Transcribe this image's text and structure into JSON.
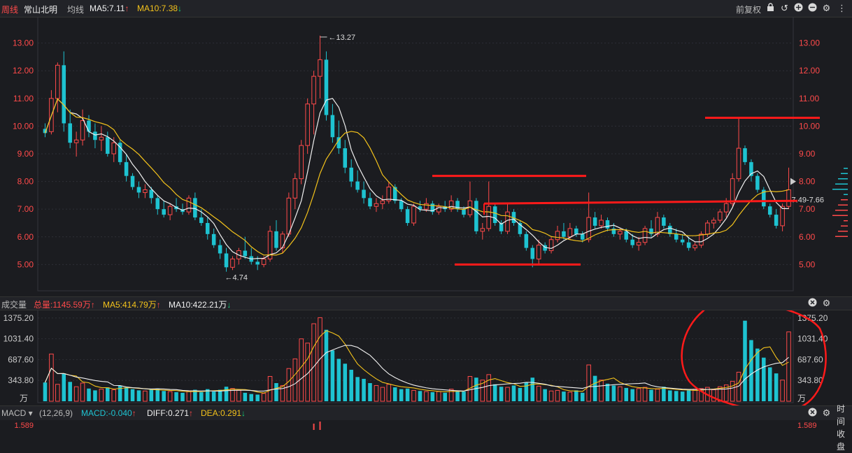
{
  "header": {
    "period": "周线",
    "stock_name": "常山北明",
    "ma_label": "均线",
    "ma5": "MA5:7.11",
    "ma10": "MA10:7.38",
    "adjust": "前复权"
  },
  "volume_header": {
    "title": "成交量",
    "total": "总量:1145.59万",
    "ma5": "MA5:414.79万",
    "ma10": "MA10:422.21万"
  },
  "macd_header": {
    "indicator": "MACD",
    "params": "(12,26,9)",
    "macd": "MACD:-0.040",
    "diff": "DIFF:0.271",
    "dea": "DEA:0.291"
  },
  "right_panel": {
    "time_label": "时间",
    "close_label": "收盘"
  },
  "colors": {
    "up": "#ff4a4a",
    "down": "#1ec3d1",
    "ma5": "#f0f0f0",
    "ma10": "#f3c21b",
    "annotation": "#ff1a1a",
    "grid": "#2e2f36",
    "axis_text": "#ff4a4a"
  },
  "chart_data": {
    "type": "candlestick",
    "price_axis": {
      "ticks": [
        "13.00",
        "12.00",
        "11.00",
        "10.00",
        "9.00",
        "8.00",
        "7.00",
        "6.00",
        "5.00"
      ],
      "ylim": [
        4.1,
        13.9
      ]
    },
    "price_annotations": {
      "high": "13.27",
      "low": "4.74",
      "current_range": "7.49-7.66"
    },
    "volume_axis": {
      "ticks": [
        "1375.20",
        "1031.40",
        "687.60",
        "343.80"
      ],
      "unit": "万",
      "ylim": [
        0,
        1500
      ]
    },
    "macd_axis": {
      "top_value": "1.589"
    },
    "candles": [
      [
        9.9,
        10.1,
        9.6,
        9.75
      ],
      [
        9.8,
        11.3,
        9.7,
        11.0
      ],
      [
        11.0,
        12.3,
        10.5,
        12.2
      ],
      [
        12.2,
        12.7,
        9.8,
        10.1
      ],
      [
        10.1,
        10.6,
        9.2,
        9.4
      ],
      [
        9.4,
        9.8,
        8.9,
        9.5
      ],
      [
        9.5,
        10.6,
        9.3,
        10.2
      ],
      [
        10.2,
        10.4,
        9.6,
        9.8
      ],
      [
        9.8,
        10.1,
        9.2,
        9.5
      ],
      [
        9.5,
        10.0,
        9.1,
        9.6
      ],
      [
        9.6,
        9.8,
        8.9,
        9.0
      ],
      [
        9.0,
        9.6,
        8.7,
        9.4
      ],
      [
        9.4,
        9.5,
        8.6,
        8.7
      ],
      [
        8.7,
        9.0,
        8.0,
        8.2
      ],
      [
        8.2,
        8.3,
        7.7,
        7.8
      ],
      [
        7.8,
        8.0,
        7.4,
        7.6
      ],
      [
        7.6,
        7.9,
        7.4,
        7.7
      ],
      [
        7.7,
        7.8,
        7.2,
        7.4
      ],
      [
        7.4,
        7.5,
        6.8,
        7.0
      ],
      [
        7.0,
        7.3,
        6.7,
        6.8
      ],
      [
        6.8,
        7.2,
        6.6,
        7.1
      ],
      [
        7.1,
        7.4,
        6.9,
        7.0
      ],
      [
        7.0,
        7.2,
        6.8,
        6.9
      ],
      [
        6.9,
        7.5,
        6.8,
        7.4
      ],
      [
        7.4,
        7.6,
        6.6,
        6.7
      ],
      [
        6.7,
        7.0,
        6.4,
        6.5
      ],
      [
        6.5,
        6.7,
        5.9,
        6.1
      ],
      [
        6.1,
        6.3,
        5.6,
        5.7
      ],
      [
        5.7,
        5.9,
        5.2,
        5.4
      ],
      [
        5.4,
        5.6,
        4.74,
        4.9
      ],
      [
        4.9,
        5.3,
        4.8,
        5.2
      ],
      [
        5.2,
        5.6,
        5.0,
        5.5
      ],
      [
        5.5,
        6.0,
        5.2,
        5.3
      ],
      [
        5.3,
        5.6,
        5.0,
        5.1
      ],
      [
        5.1,
        5.3,
        4.8,
        5.0
      ],
      [
        5.0,
        5.3,
        4.9,
        5.2
      ],
      [
        5.2,
        6.4,
        5.1,
        6.2
      ],
      [
        6.2,
        6.6,
        5.5,
        5.6
      ],
      [
        5.6,
        6.2,
        5.4,
        6.1
      ],
      [
        6.1,
        7.6,
        6.0,
        7.4
      ],
      [
        7.4,
        8.3,
        7.0,
        8.1
      ],
      [
        8.1,
        9.5,
        7.9,
        9.3
      ],
      [
        9.3,
        11.0,
        9.0,
        10.8
      ],
      [
        10.8,
        12.0,
        9.7,
        11.8
      ],
      [
        11.8,
        13.27,
        11.0,
        12.4
      ],
      [
        12.4,
        12.7,
        10.2,
        10.4
      ],
      [
        10.4,
        10.8,
        9.4,
        9.6
      ],
      [
        9.6,
        10.2,
        9.0,
        9.2
      ],
      [
        9.2,
        9.5,
        8.3,
        8.5
      ],
      [
        8.5,
        8.8,
        7.8,
        8.0
      ],
      [
        8.0,
        8.4,
        7.6,
        7.7
      ],
      [
        7.7,
        8.0,
        7.2,
        7.4
      ],
      [
        7.4,
        7.6,
        7.0,
        7.1
      ],
      [
        7.1,
        7.4,
        6.9,
        7.2
      ],
      [
        7.2,
        7.5,
        7.0,
        7.3
      ],
      [
        7.3,
        8.0,
        7.2,
        7.8
      ],
      [
        7.8,
        7.9,
        7.2,
        7.3
      ],
      [
        7.3,
        7.4,
        6.9,
        7.0
      ],
      [
        7.0,
        7.1,
        6.4,
        6.5
      ],
      [
        6.5,
        7.2,
        6.4,
        7.1
      ],
      [
        7.1,
        7.3,
        6.9,
        7.0
      ],
      [
        7.0,
        7.4,
        6.9,
        7.2
      ],
      [
        7.2,
        7.3,
        6.8,
        6.9
      ],
      [
        6.9,
        7.2,
        6.8,
        7.1
      ],
      [
        7.1,
        7.3,
        6.9,
        7.0
      ],
      [
        7.0,
        7.5,
        6.9,
        7.3
      ],
      [
        7.3,
        7.4,
        6.9,
        7.0
      ],
      [
        7.0,
        7.1,
        6.7,
        6.8
      ],
      [
        6.8,
        8.0,
        6.7,
        7.3
      ],
      [
        7.3,
        7.4,
        6.1,
        6.2
      ],
      [
        6.2,
        6.5,
        5.9,
        6.3
      ],
      [
        6.3,
        8.0,
        6.2,
        7.1
      ],
      [
        7.1,
        7.2,
        6.4,
        6.5
      ],
      [
        6.5,
        6.6,
        6.1,
        6.2
      ],
      [
        6.2,
        7.2,
        6.1,
        6.9
      ],
      [
        6.9,
        7.0,
        6.4,
        6.5
      ],
      [
        6.5,
        6.6,
        6.0,
        6.1
      ],
      [
        6.1,
        6.2,
        5.5,
        5.6
      ],
      [
        5.6,
        5.7,
        4.9,
        5.2
      ],
      [
        5.2,
        5.9,
        5.0,
        5.7
      ],
      [
        5.7,
        5.8,
        5.4,
        5.5
      ],
      [
        5.5,
        6.0,
        5.4,
        5.9
      ],
      [
        5.9,
        6.4,
        5.8,
        6.2
      ],
      [
        6.2,
        6.5,
        5.9,
        6.0
      ],
      [
        6.0,
        6.5,
        5.9,
        6.3
      ],
      [
        6.3,
        6.4,
        6.0,
        6.1
      ],
      [
        6.1,
        6.2,
        5.8,
        5.9
      ],
      [
        5.9,
        7.6,
        5.8,
        6.7
      ],
      [
        6.7,
        6.9,
        6.3,
        6.4
      ],
      [
        6.4,
        6.8,
        6.3,
        6.6
      ],
      [
        6.6,
        6.7,
        6.2,
        6.3
      ],
      [
        6.3,
        6.5,
        6.0,
        6.1
      ],
      [
        6.1,
        6.3,
        5.9,
        6.2
      ],
      [
        6.2,
        6.3,
        5.8,
        5.9
      ],
      [
        5.9,
        6.1,
        5.6,
        5.7
      ],
      [
        5.7,
        6.0,
        5.5,
        5.8
      ],
      [
        5.8,
        6.4,
        5.7,
        6.3
      ],
      [
        6.3,
        6.6,
        6.0,
        6.1
      ],
      [
        6.1,
        6.9,
        6.0,
        6.7
      ],
      [
        6.7,
        6.8,
        6.3,
        6.4
      ],
      [
        6.4,
        6.5,
        6.0,
        6.1
      ],
      [
        6.1,
        6.3,
        5.8,
        5.9
      ],
      [
        5.9,
        6.1,
        5.7,
        5.8
      ],
      [
        5.8,
        6.0,
        5.5,
        5.6
      ],
      [
        5.6,
        5.8,
        5.5,
        5.7
      ],
      [
        5.7,
        6.2,
        5.6,
        6.1
      ],
      [
        6.1,
        6.6,
        6.0,
        6.5
      ],
      [
        6.5,
        6.7,
        6.3,
        6.6
      ],
      [
        6.6,
        7.0,
        6.5,
        6.9
      ],
      [
        6.9,
        7.4,
        6.7,
        7.2
      ],
      [
        7.2,
        8.3,
        7.1,
        8.1
      ],
      [
        8.1,
        10.3,
        8.0,
        9.2
      ],
      [
        9.2,
        9.3,
        8.6,
        8.7
      ],
      [
        8.7,
        8.8,
        8.0,
        8.2
      ],
      [
        8.2,
        8.3,
        7.6,
        7.7
      ],
      [
        7.7,
        7.8,
        7.0,
        7.1
      ],
      [
        7.1,
        7.2,
        6.7,
        6.8
      ],
      [
        6.8,
        7.0,
        6.3,
        6.4
      ],
      [
        6.4,
        7.2,
        6.2,
        7.1
      ],
      [
        7.1,
        8.5,
        7.0,
        7.7
      ]
    ],
    "volumes": [
      310,
      780,
      280,
      460,
      320,
      240,
      300,
      210,
      180,
      200,
      230,
      190,
      260,
      230,
      200,
      180,
      170,
      190,
      210,
      170,
      160,
      150,
      140,
      170,
      190,
      150,
      200,
      160,
      190,
      240,
      210,
      180,
      140,
      120,
      110,
      130,
      410,
      300,
      260,
      540,
      700,
      1030,
      960,
      1280,
      1380,
      1180,
      840,
      700,
      620,
      520,
      400,
      370,
      300,
      260,
      230,
      280,
      230,
      200,
      210,
      180,
      170,
      160,
      150,
      160,
      140,
      200,
      170,
      160,
      410,
      390,
      350,
      440,
      280,
      240,
      230,
      260,
      220,
      310,
      390,
      250,
      200,
      170,
      180,
      160,
      150,
      180,
      140,
      600,
      420,
      350,
      290,
      260,
      240,
      220,
      200,
      210,
      230,
      190,
      200,
      240,
      180,
      170,
      160,
      180,
      200,
      210,
      230,
      190,
      240,
      270,
      330,
      480,
      1330,
      1010,
      870,
      720,
      560,
      460,
      350,
      1145
    ]
  }
}
